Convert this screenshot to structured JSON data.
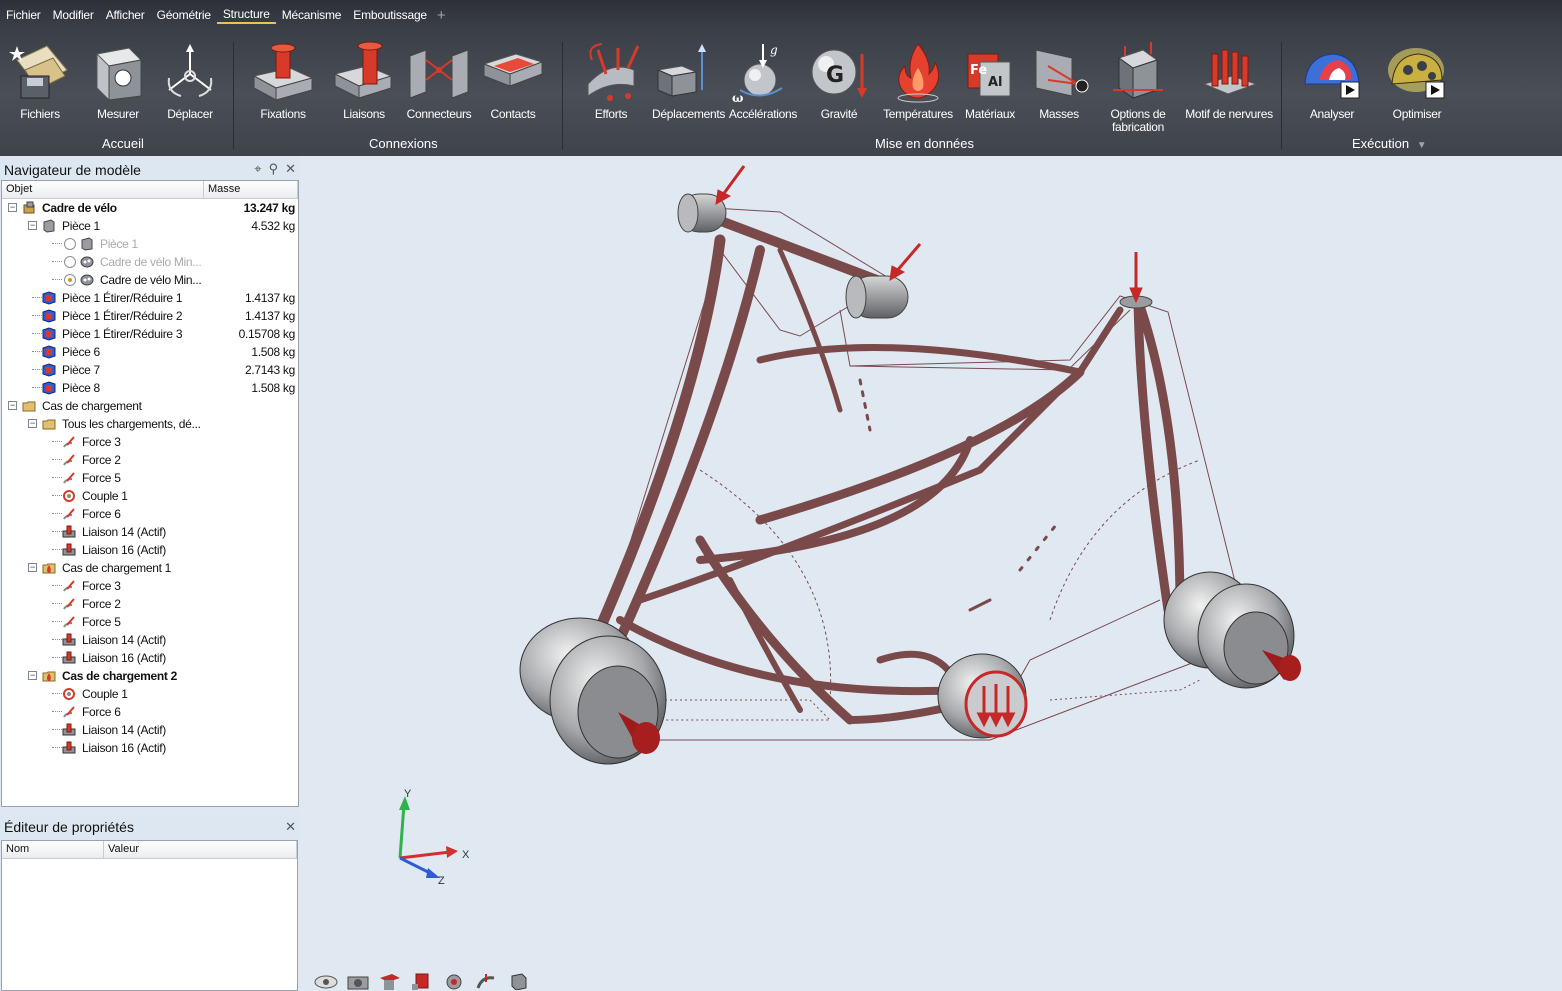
{
  "menu": {
    "items": [
      "Fichier",
      "Modifier",
      "Afficher",
      "Géométrie",
      "Structure",
      "Mécanisme",
      "Emboutissage"
    ],
    "active": "Structure",
    "plus": "+"
  },
  "ribbon": {
    "tools": {
      "fichiers": "Fichiers",
      "mesurer": "Mesurer",
      "deplacer": "Déplacer",
      "fixations": "Fixations",
      "liaisons": "Liaisons",
      "connecteurs": "Connecteurs",
      "contacts": "Contacts",
      "efforts": "Efforts",
      "deplacements": "Déplacements",
      "accelerations": "Accélérations",
      "gravite": "Gravité",
      "temperatures": "Températures",
      "materiaux": "Matériaux",
      "masses": "Masses",
      "options_fab_1": "Options de",
      "options_fab_2": "fabrication",
      "motif": "Motif de nervures",
      "analyser": "Analyser",
      "optimiser": "Optimiser"
    },
    "groups": {
      "accueil": "Accueil",
      "connexions": "Connexions",
      "mise": "Mise en données",
      "execution": "Exécution"
    },
    "icon_glyphs": {
      "gravity_letter": "G",
      "accel_g": "g",
      "accel_omega": "ω",
      "mat_fe": "Fe",
      "mat_al": "Al"
    }
  },
  "navigator": {
    "title": "Navigateur de modèle",
    "col_object": "Objet",
    "col_mass": "Masse",
    "rows": [
      {
        "name": "Cadre de vélo",
        "mass": "13.247 kg"
      },
      {
        "name": "Pièce 1",
        "mass": "4.532 kg"
      },
      {
        "name": "Pièce 1",
        "mass": ""
      },
      {
        "name": "Cadre de vélo Min...",
        "mass": ""
      },
      {
        "name": "Cadre de vélo Min...",
        "mass": ""
      },
      {
        "name": "Pièce 1 Étirer/Réduire 1",
        "mass": "1.4137 kg"
      },
      {
        "name": "Pièce 1 Étirer/Réduire 2",
        "mass": "1.4137 kg"
      },
      {
        "name": "Pièce 1 Étirer/Réduire 3",
        "mass": "0.15708 kg"
      },
      {
        "name": "Pièce 6",
        "mass": "1.508 kg"
      },
      {
        "name": "Pièce 7",
        "mass": "2.7143 kg"
      },
      {
        "name": "Pièce 8",
        "mass": "1.508 kg"
      },
      {
        "name": "Cas de chargement",
        "mass": ""
      },
      {
        "name": "Tous les chargements, dé...",
        "mass": ""
      },
      {
        "name": "Force 3",
        "mass": ""
      },
      {
        "name": "Force 2",
        "mass": ""
      },
      {
        "name": "Force 5",
        "mass": ""
      },
      {
        "name": "Couple 1",
        "mass": ""
      },
      {
        "name": "Force 6",
        "mass": ""
      },
      {
        "name": "Liaison 14 (Actif)",
        "mass": ""
      },
      {
        "name": "Liaison 16 (Actif)",
        "mass": ""
      },
      {
        "name": "Cas de chargement 1",
        "mass": ""
      },
      {
        "name": "Force 3",
        "mass": ""
      },
      {
        "name": "Force 2",
        "mass": ""
      },
      {
        "name": "Force 5",
        "mass": ""
      },
      {
        "name": "Liaison 14 (Actif)",
        "mass": ""
      },
      {
        "name": "Liaison 16 (Actif)",
        "mass": ""
      },
      {
        "name": "Cas de chargement 2",
        "mass": ""
      },
      {
        "name": "Couple 1",
        "mass": ""
      },
      {
        "name": "Force 6",
        "mass": ""
      },
      {
        "name": "Liaison 14 (Actif)",
        "mass": ""
      },
      {
        "name": "Liaison 16 (Actif)",
        "mass": ""
      }
    ]
  },
  "properties": {
    "title": "Éditeur de propriétés",
    "col_name": "Nom",
    "col_value": "Valeur"
  },
  "axes": {
    "x": "X",
    "y": "Y",
    "z": "Z"
  },
  "colors": {
    "frame": "#7a4a4a",
    "arrow": "#c62828",
    "ribbon_dark": "#3a3e46",
    "viewport_bg": "#e0e9f2"
  }
}
